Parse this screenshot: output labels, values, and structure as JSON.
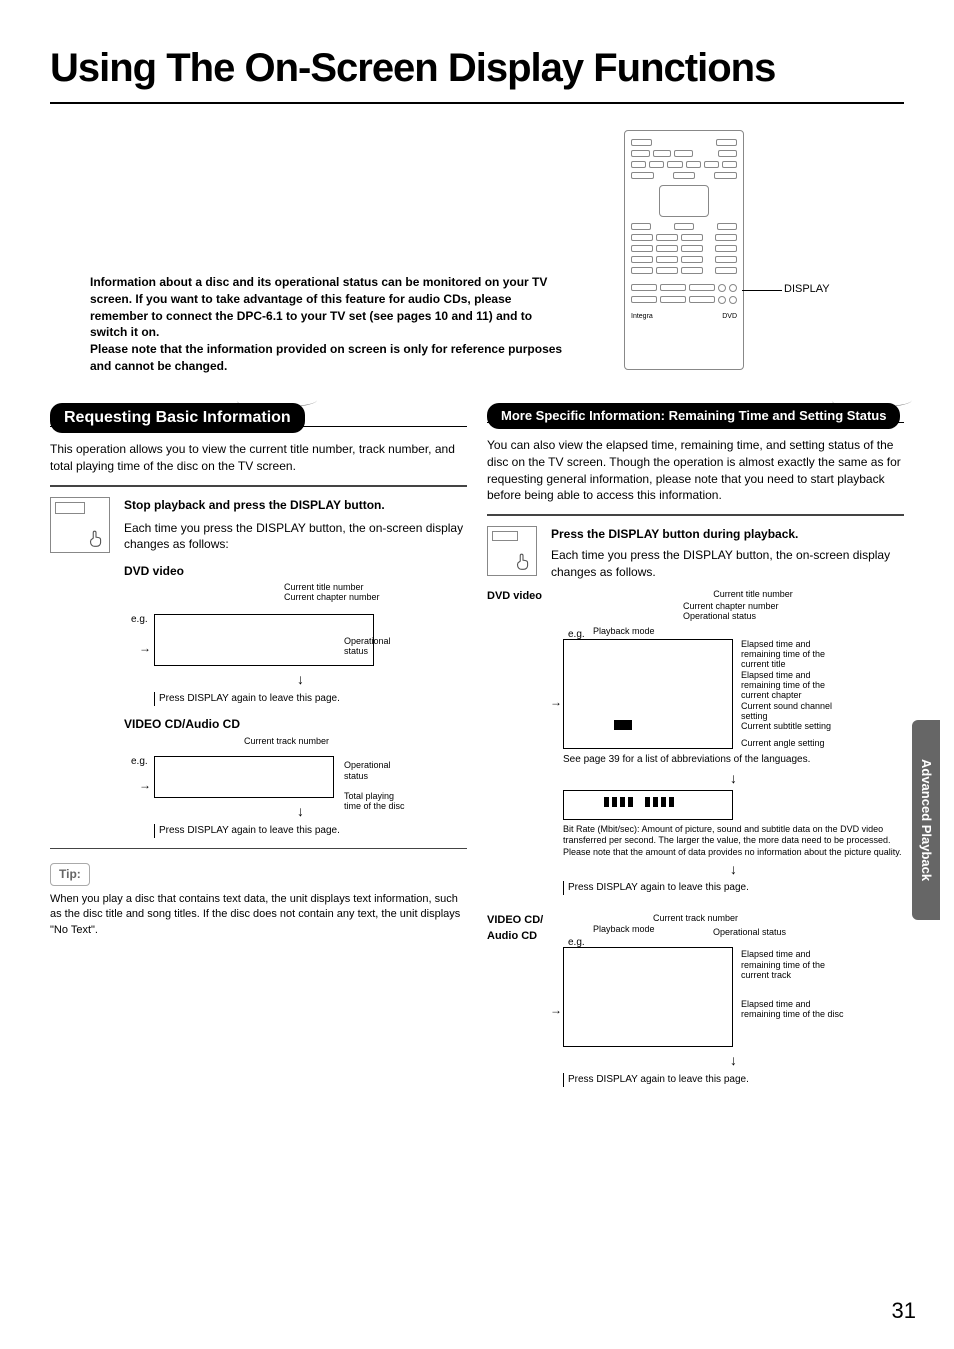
{
  "title": "Using The On-Screen Display Functions",
  "remote": {
    "callout": "DISPLAY",
    "logo_left": "Integra",
    "logo_right": "DVD"
  },
  "intro": "Information about a disc and its operational status can be monitored on your TV screen. If you want to take advantage of this feature for audio CDs, please remember to connect the DPC-6.1 to your TV set (see pages 10 and 11) and to switch it on.\nPlease note that the information provided on screen is only for reference purposes and cannot be changed.",
  "left": {
    "heading": "Requesting Basic Information",
    "para": "This operation allows you to view the current title number, track number, and total playing time of the disc on the TV screen.",
    "step_title": "Stop playback and press the DISPLAY button.",
    "step_body": "Each time you press the DISPLAY button, the on-screen display changes as follows:",
    "dvd_label": "DVD video",
    "dvd_callouts": {
      "title_no": "Current title number",
      "chapter_no": "Current chapter number",
      "op_status": "Operational status",
      "press_again": "Press DISPLAY again to leave this page.",
      "eg": "e.g."
    },
    "vcd_label": "VIDEO CD/Audio CD",
    "vcd_callouts": {
      "track_no": "Current track number",
      "op_status": "Operational status",
      "total_time": "Total playing time of the disc",
      "press_again": "Press DISPLAY again to leave this page.",
      "eg": "e.g."
    },
    "tip_label": "Tip:",
    "tip_body": "When you play a disc that contains text data, the unit displays text information, such as the disc title and song titles. If the disc does not contain any text, the unit displays \"No Text\"."
  },
  "right": {
    "heading": "More Specific Information: Remaining Time and Setting Status",
    "para": "You can also view the elapsed time, remaining time, and setting status of the disc on the TV screen. Though the operation is almost exactly the same as for requesting general information, please note that you need to start playback before being able to access this information.",
    "step_title": "Press the DISPLAY button during playback.",
    "step_body": "Each time you press the DISPLAY button, the on-screen display changes as follows.",
    "dvd_label": "DVD video",
    "dvd_callouts": {
      "pb_mode": "Playback mode",
      "title_no": "Current title number",
      "chapter_no": "Current chapter number",
      "op_status": "Operational status",
      "elapsed_title": "Elapsed time and remaining time of the current title",
      "elapsed_chapter": "Elapsed time and remaining time of the current chapter",
      "sound": "Current sound channel setting",
      "subtitle": "Current subtitle setting",
      "angle": "Current angle setting",
      "eg": "e.g.",
      "lang_note": "See page 39 for a list of abbreviations of the languages.",
      "bitrate": "Bit Rate (Mbit/sec): Amount of picture, sound and subtitle data on the DVD video transferred per second. The larger the value, the more data need to be processed. Please note that the amount of data provides no information about the picture quality.",
      "press_again": "Press DISPLAY again to leave this page."
    },
    "vcd_label": "VIDEO CD/ Audio CD",
    "vcd_callouts": {
      "pb_mode": "Playback mode",
      "track_no": "Current track number",
      "op_status": "Operational status",
      "elapsed_track": "Elapsed time and remaining time of the current track",
      "elapsed_disc": "Elapsed time and remaining time of the disc",
      "eg": "e.g.",
      "press_again": "Press DISPLAY again to leave this page."
    }
  },
  "side_tab": "Advanced Playback",
  "page_number": "31"
}
